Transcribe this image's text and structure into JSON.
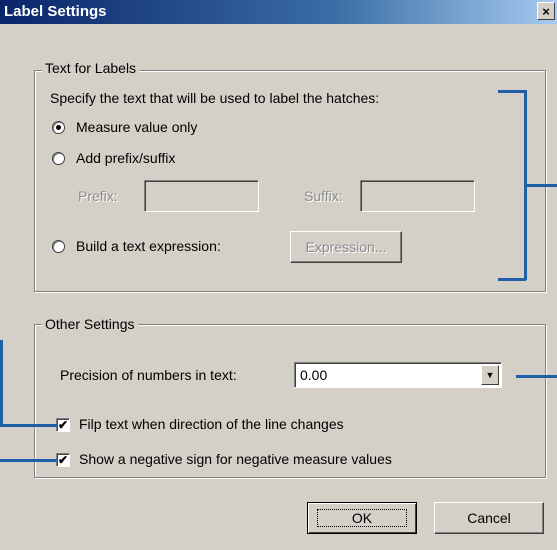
{
  "dialog": {
    "title": "Label Settings",
    "close_glyph": "×"
  },
  "text_for_labels": {
    "legend": "Text for Labels",
    "description": "Specify the text that will be used to label the hatches:",
    "options": [
      {
        "label": "Measure value only",
        "selected": true
      },
      {
        "label": "Add prefix/suffix",
        "selected": false
      },
      {
        "label": "Build a text expression:",
        "selected": false
      }
    ],
    "prefix_label": "Prefix:",
    "prefix_value": "",
    "suffix_label": "Suffix:",
    "suffix_value": "",
    "expression_button": "Expression..."
  },
  "other_settings": {
    "legend": "Other Settings",
    "precision_label": "Precision of numbers in text:",
    "precision_value": "0.00",
    "flip_text_label": "Filp text when direction of the line changes",
    "flip_text_checked": true,
    "negative_sign_label": "Show a negative sign for negative measure values",
    "negative_sign_checked": true,
    "check_glyph": "✔"
  },
  "buttons": {
    "ok": "OK",
    "cancel": "Cancel"
  },
  "colors": {
    "dialog_bg": "#d4d0c8",
    "title_gradient_start": "#0a246a",
    "callout_line": "#1f5fa8"
  }
}
